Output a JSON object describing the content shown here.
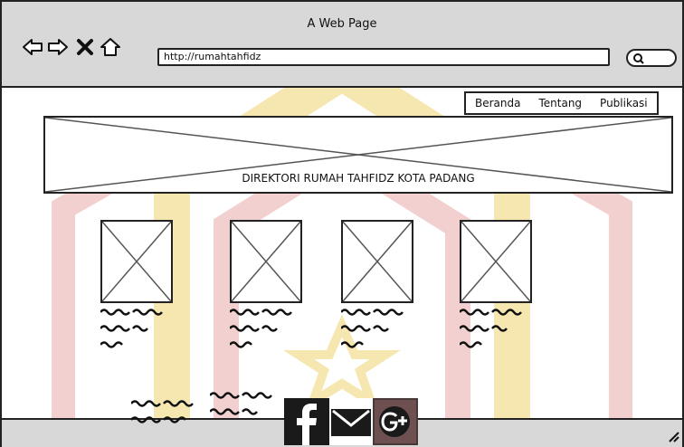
{
  "window": {
    "title": "A Web Page"
  },
  "browser": {
    "url": "http://rumahtahfidz"
  },
  "nav_menu": [
    "Beranda",
    "Tentang",
    "Publikasi"
  ],
  "banner": {
    "text": "DIREKTORI RUMAH TAHFIDZ KOTA PADANG"
  },
  "cards": [
    {
      "image": "image-placeholder-icon",
      "text_lines": 3
    },
    {
      "image": "image-placeholder-icon",
      "text_lines": 3
    },
    {
      "image": "image-placeholder-icon",
      "text_lines": 3
    },
    {
      "image": "image-placeholder-icon",
      "text_lines": 3
    }
  ],
  "footer_text_blocks": 2,
  "social_icons": [
    "facebook-icon",
    "email-icon",
    "google-plus-icon"
  ],
  "colors": {
    "chrome": "#d8d8d8",
    "border": "#222222",
    "watermark": "#f4e3a8",
    "watermark_red": "#f0c8c8"
  }
}
